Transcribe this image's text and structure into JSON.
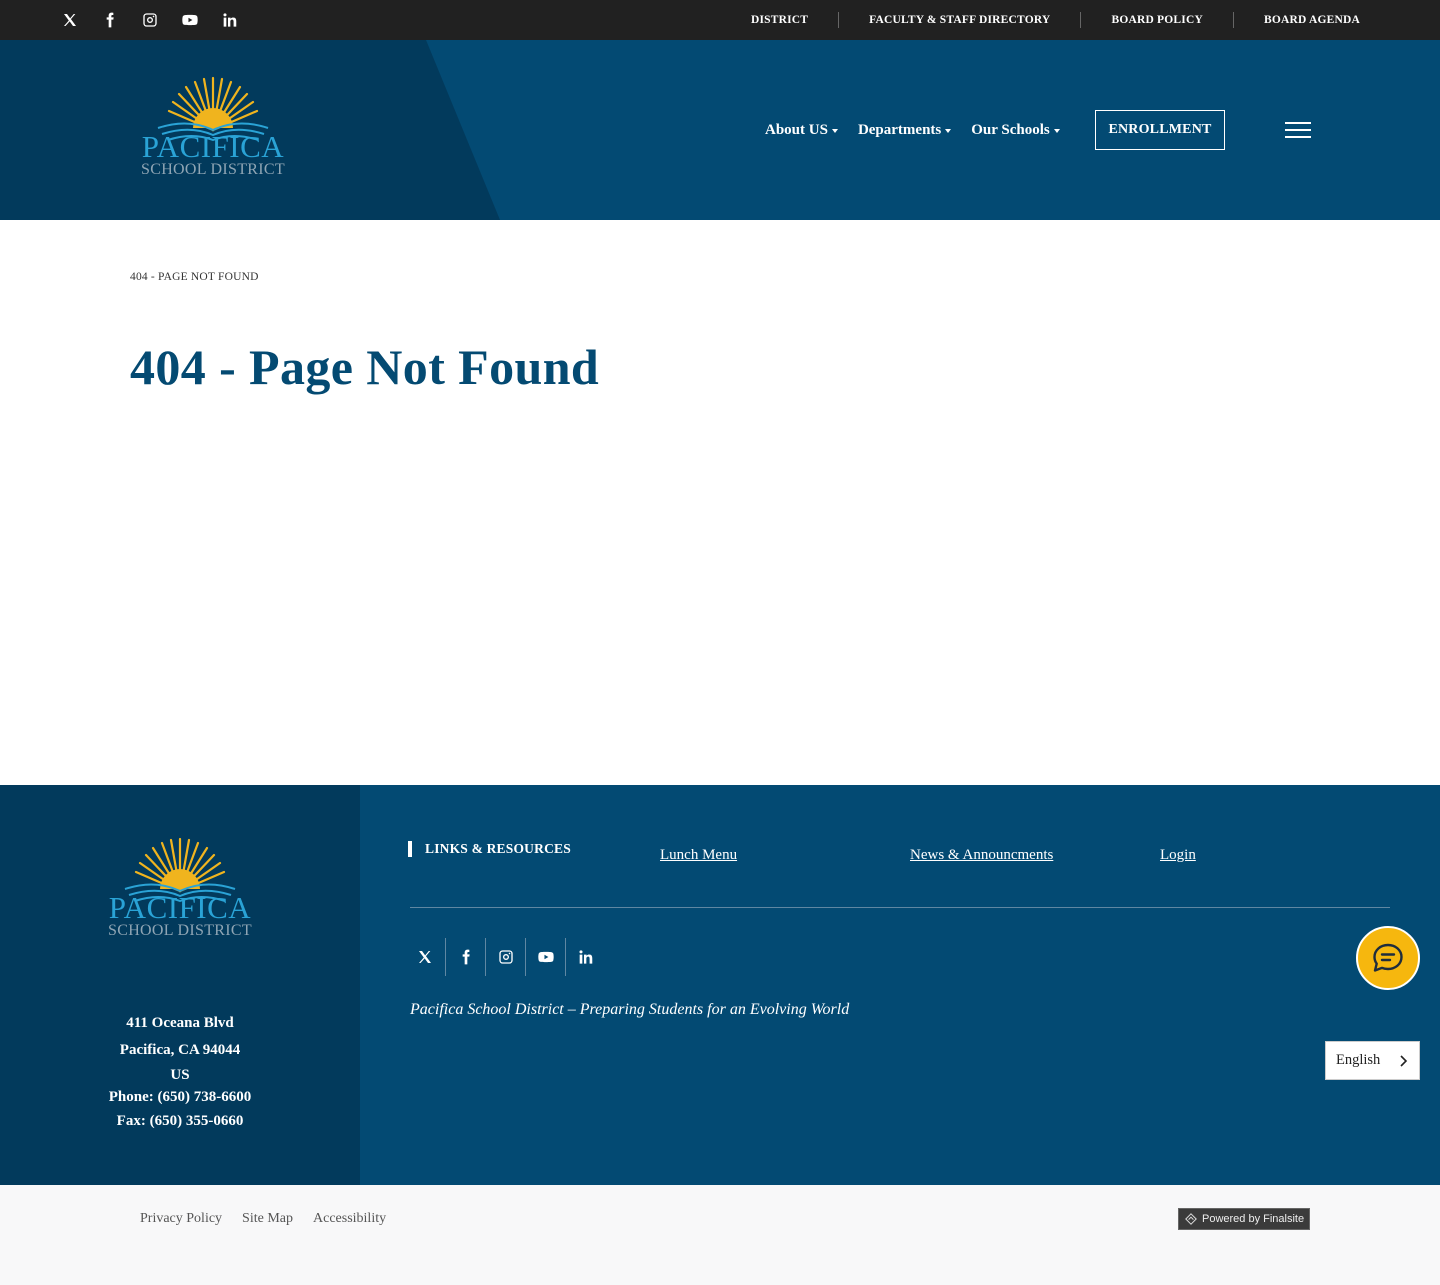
{
  "topbar": {
    "social": [
      {
        "icon": "x-twitter-icon"
      },
      {
        "icon": "facebook-icon"
      },
      {
        "icon": "instagram-icon"
      },
      {
        "icon": "youtube-icon"
      },
      {
        "icon": "linkedin-icon"
      }
    ],
    "links": [
      "DISTRICT",
      "FACULTY & STAFF DIRECTORY",
      "BOARD POLICY",
      "BOARD AGENDA"
    ]
  },
  "header": {
    "logo": {
      "line1": "PACIFICA",
      "line2": "SCHOOL DISTRICT"
    },
    "nav": [
      {
        "label": "About US"
      },
      {
        "label": "Departments"
      },
      {
        "label": "Our Schools"
      }
    ],
    "enroll_label": "ENROLLMENT"
  },
  "page": {
    "breadcrumb": "404 - PAGE NOT FOUND",
    "title": "404 - Page Not Found"
  },
  "footer": {
    "logo": {
      "line1": "PACIFICA",
      "line2": "SCHOOL DISTRICT"
    },
    "address": {
      "street": "411 Oceana Blvd",
      "city": "Pacifica, CA  94044",
      "country": "US",
      "phone": "Phone: (650) 738-6600",
      "fax": "Fax: (650) 355-0660"
    },
    "links_heading": "LINKS & RESOURCES",
    "links": [
      "Lunch Menu",
      "News & Announcments",
      "Login"
    ],
    "tagline": "Pacifica School District – Preparing Students for an Evolving World",
    "language": "English"
  },
  "bottom": {
    "links": [
      "Privacy Policy",
      "Site Map",
      "Accessibility"
    ],
    "powered": "Powered by Finalsite"
  },
  "colors": {
    "topbar": "#212121",
    "primary": "#034a73",
    "primary_dark": "#023a5c",
    "title": "#044a72",
    "logo_blue": "#2aa3d6",
    "sun": "#f0b41e",
    "chat": "#f6b70e"
  }
}
